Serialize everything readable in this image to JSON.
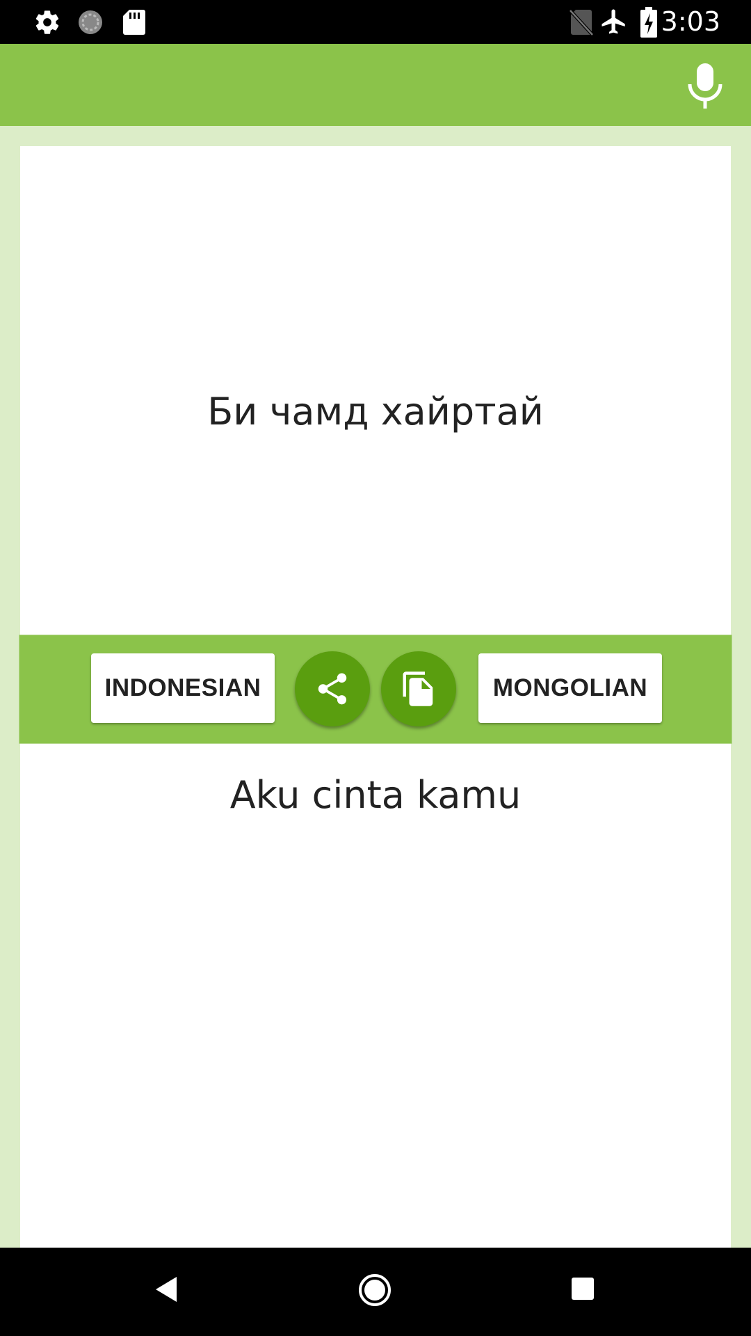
{
  "status_bar": {
    "time": "3:03",
    "icons": [
      "settings-icon",
      "sync-icon",
      "sd-card-icon",
      "no-sim-icon",
      "airplane-mode-icon",
      "battery-charging-icon"
    ]
  },
  "app_bar": {
    "action_icon": "microphone-icon"
  },
  "translator": {
    "output_text": "Би чамд хайртай",
    "input_text": "Aku cinta kamu",
    "source_language": "INDONESIAN",
    "target_language": "MONGOLIAN",
    "share_icon": "share-icon",
    "copy_icon": "copy-icon"
  },
  "nav_bar": {
    "icons": [
      "back-icon",
      "home-icon",
      "recents-icon"
    ]
  },
  "colors": {
    "primary": "#8bc34a",
    "primary_dark": "#5a9e0f",
    "background": "#dcedc8"
  }
}
